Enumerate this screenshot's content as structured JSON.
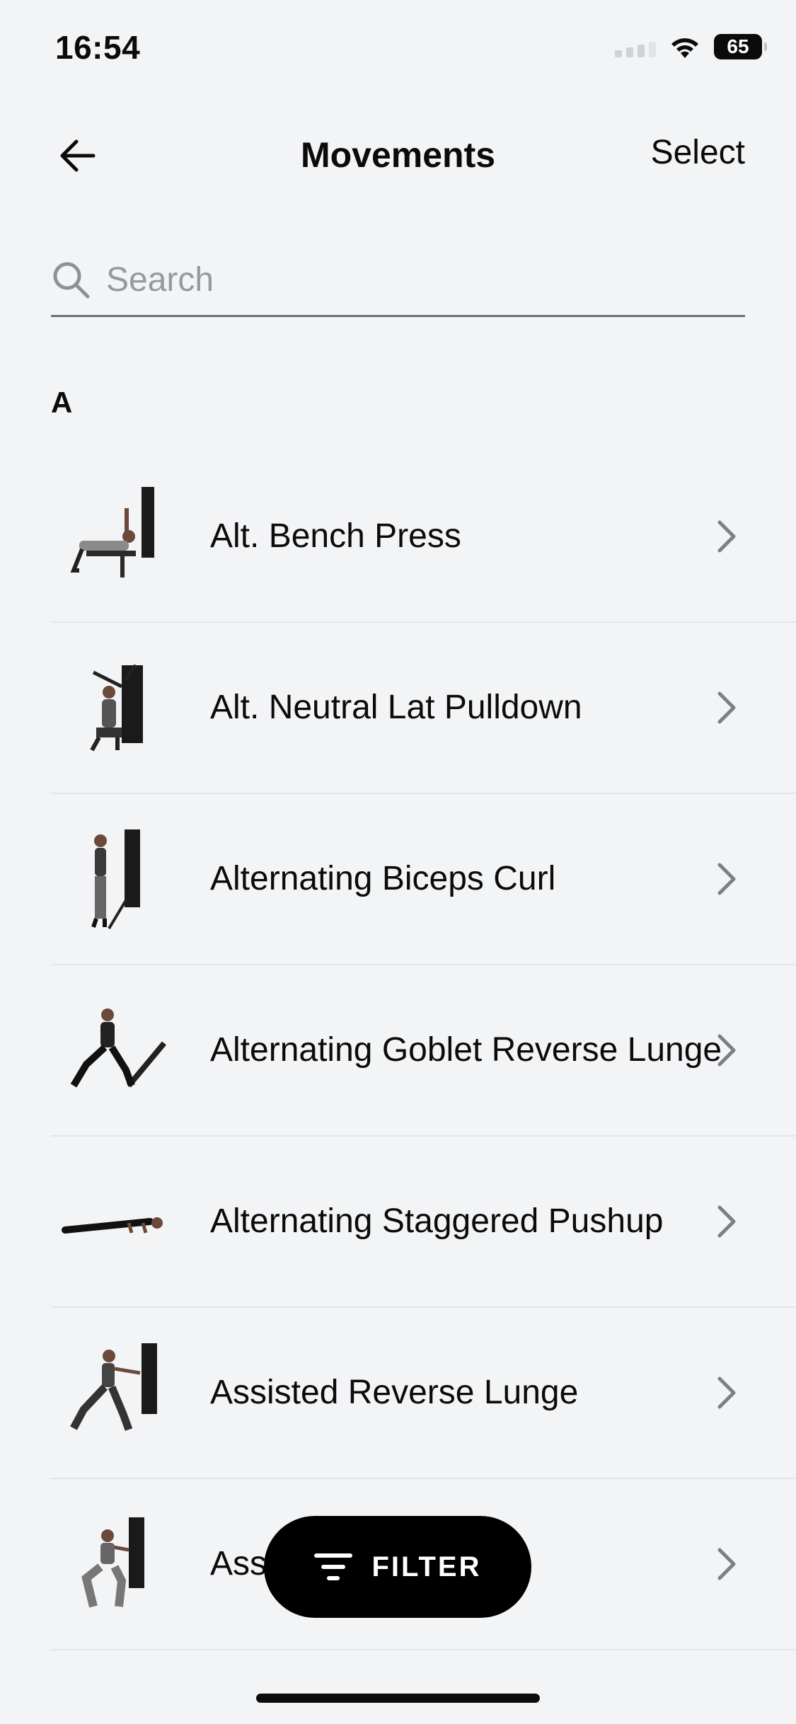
{
  "status_bar": {
    "time": "16:54",
    "battery": "65"
  },
  "nav": {
    "title": "Movements",
    "select_label": "Select"
  },
  "search": {
    "placeholder": "Search",
    "value": ""
  },
  "section": {
    "letter": "A"
  },
  "movements": [
    {
      "label": "Alt. Bench Press"
    },
    {
      "label": "Alt. Neutral Lat Pulldown"
    },
    {
      "label": "Alternating Biceps Curl"
    },
    {
      "label": "Alternating Goblet Reverse Lunge"
    },
    {
      "label": "Alternating Staggered Pushup"
    },
    {
      "label": "Assisted Reverse Lunge"
    },
    {
      "label": "Ass"
    }
  ],
  "filter": {
    "label": "FILTER"
  },
  "colors": {
    "background": "#f3f4f6",
    "text": "#0b0b0b",
    "filter_bg": "#000000",
    "divider": "#e3e5e8"
  }
}
